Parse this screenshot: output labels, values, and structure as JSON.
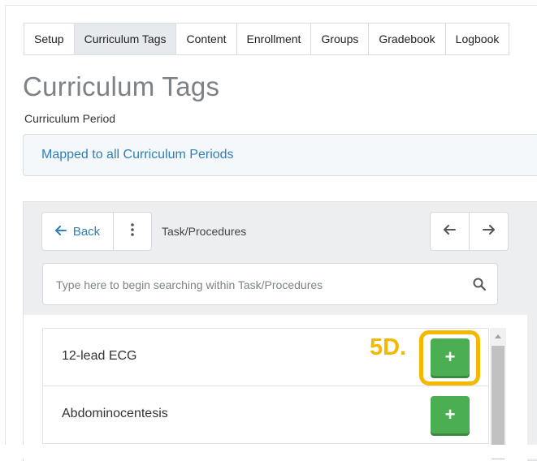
{
  "tabs": [
    {
      "label": "Setup",
      "active": false
    },
    {
      "label": "Curriculum Tags",
      "active": true
    },
    {
      "label": "Content",
      "active": false
    },
    {
      "label": "Enrollment",
      "active": false
    },
    {
      "label": "Groups",
      "active": false
    },
    {
      "label": "Gradebook",
      "active": false
    },
    {
      "label": "Logbook",
      "active": false
    }
  ],
  "page_title": "Curriculum Tags",
  "curriculum_period": {
    "label": "Curriculum Period",
    "value": "Mapped to all Curriculum Periods"
  },
  "browser": {
    "back_label": "Back",
    "back_icon": "arrow-left-icon",
    "menu_icon": "kebab-icon",
    "breadcrumb": "Task/Procedures",
    "prev_icon": "arrow-left-icon",
    "next_icon": "arrow-right-icon",
    "search_placeholder": "Type here to begin searching within Task/Procedures",
    "search_value": "",
    "search_icon": "search-icon"
  },
  "items": [
    {
      "label": "12-lead ECG",
      "add_label": "+"
    },
    {
      "label": "Abdominocentesis",
      "add_label": "+"
    }
  ],
  "annotation": {
    "label": "5D.",
    "color": "#f5b800"
  },
  "colors": {
    "accent": "#2f7fb8",
    "add_button": "#4cae52",
    "active_tab": "#e6e9ee",
    "title": "#7b8288"
  }
}
